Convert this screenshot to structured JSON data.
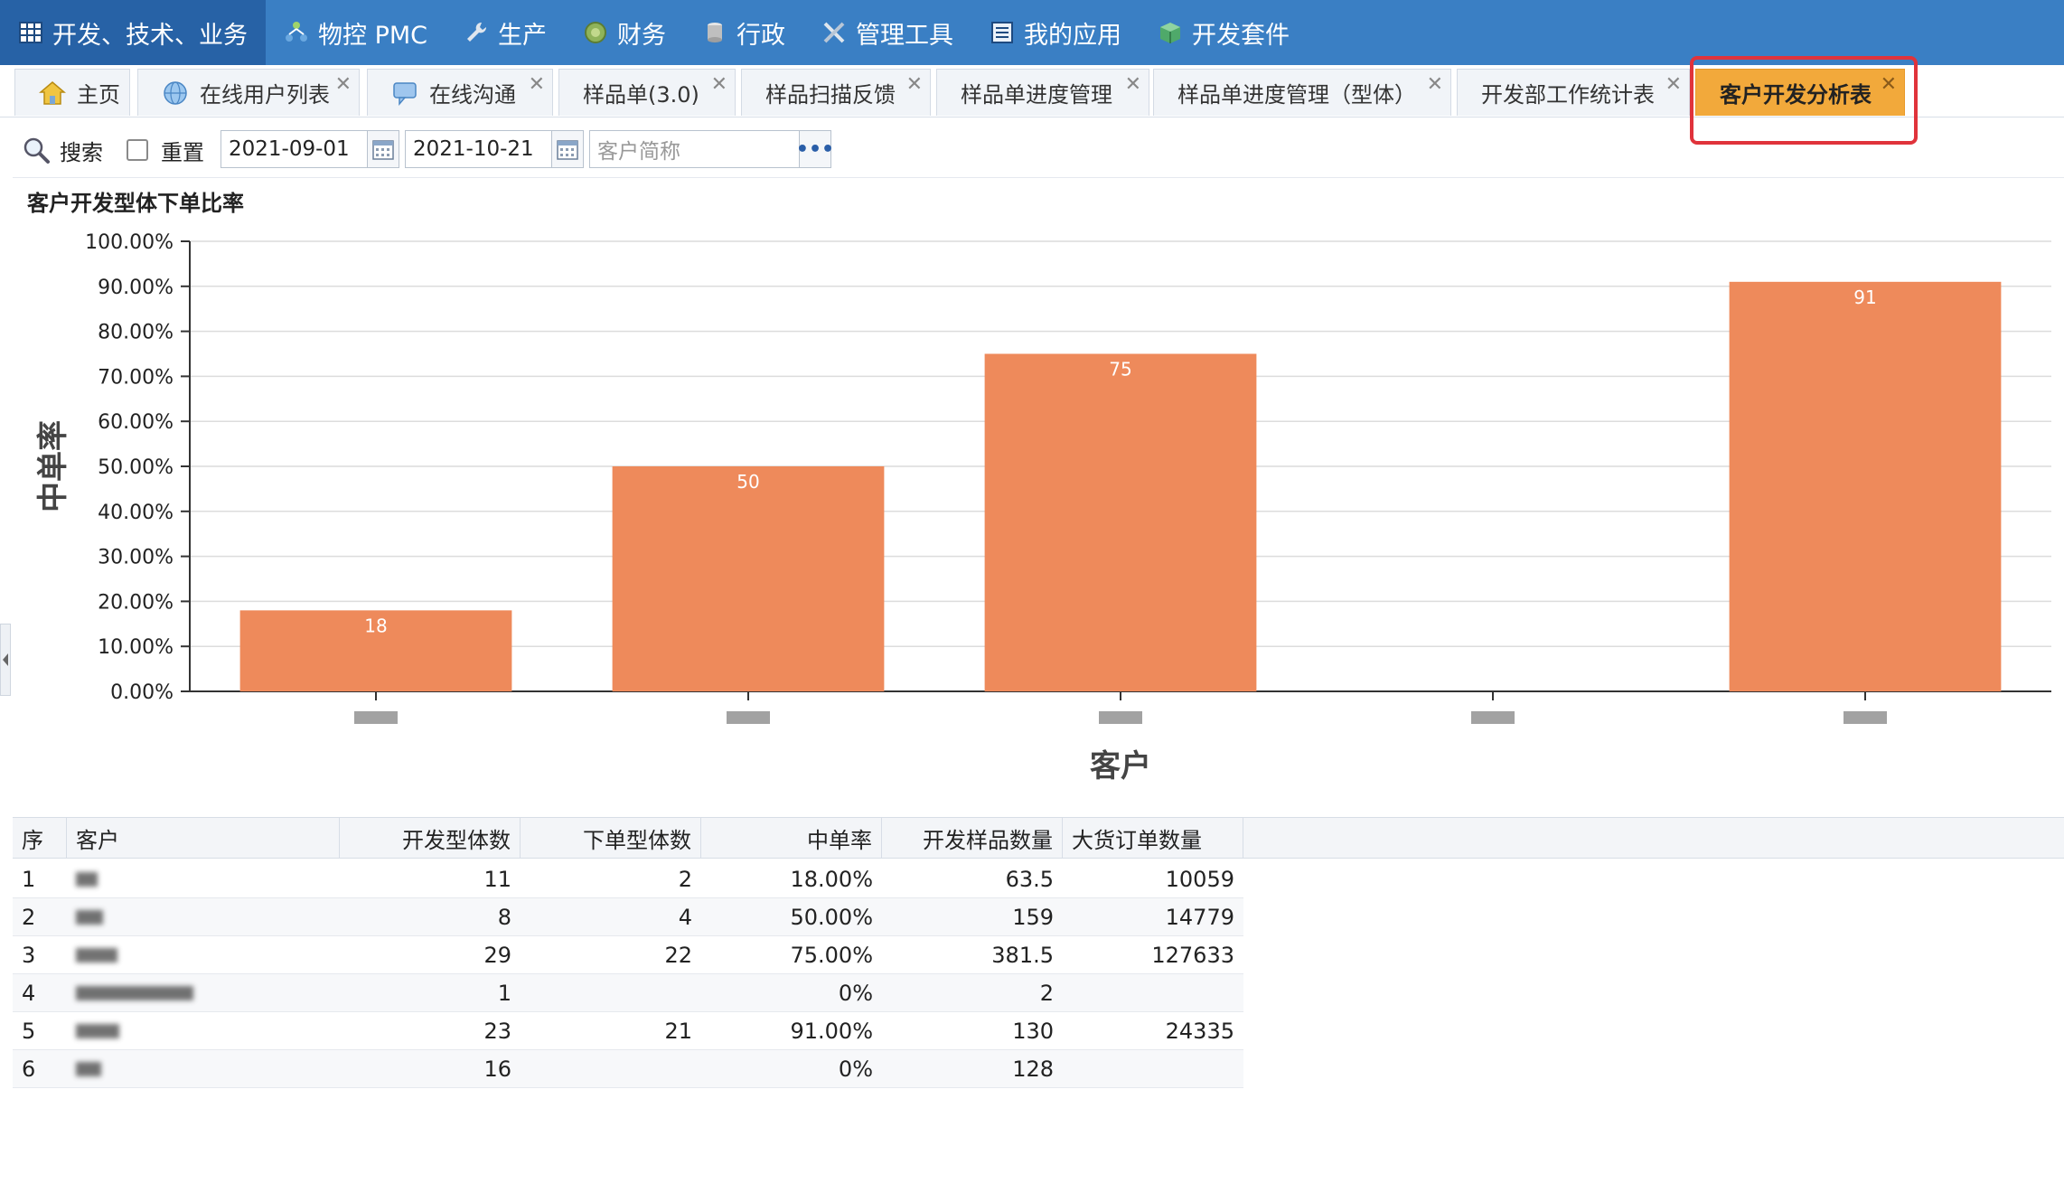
{
  "nav": {
    "items": [
      {
        "label": "开发、技术、业务",
        "icon": "grid-icon"
      },
      {
        "label": "物控 PMC",
        "icon": "network-icon"
      },
      {
        "label": "生产",
        "icon": "wrench-icon"
      },
      {
        "label": "财务",
        "icon": "coins-icon"
      },
      {
        "label": "行政",
        "icon": "database-icon"
      },
      {
        "label": "管理工具",
        "icon": "tools-icon"
      },
      {
        "label": "我的应用",
        "icon": "app-list-icon"
      },
      {
        "label": "开发套件",
        "icon": "package-icon"
      }
    ]
  },
  "tabs": [
    {
      "label": "主页",
      "icon": "home-icon",
      "closable": false
    },
    {
      "label": "在线用户列表",
      "icon": "globe-icon",
      "closable": true
    },
    {
      "label": "在线沟通",
      "icon": "chat-icon",
      "closable": true
    },
    {
      "label": "样品单(3.0)",
      "closable": true
    },
    {
      "label": "样品扫描反馈",
      "closable": true
    },
    {
      "label": "样品单进度管理",
      "closable": true
    },
    {
      "label": "样品单进度管理（型体）",
      "closable": true
    },
    {
      "label": "开发部工作统计表",
      "closable": true
    },
    {
      "label": "客户开发分析表",
      "closable": true,
      "active": true
    }
  ],
  "toolbar": {
    "search_label": "搜索",
    "reset_label": "重置",
    "start_date": "2021-09-01",
    "end_date": "2021-10-21",
    "customer_placeholder": "客户简称",
    "more_label": "•••"
  },
  "chart_data": {
    "type": "bar",
    "title": "客户开发型体下单比率",
    "xlabel": "客户",
    "ylabel": "中单率",
    "categories": [
      "",
      "",
      "",
      "",
      ""
    ],
    "values": [
      18,
      50,
      75,
      0,
      91
    ],
    "data_labels": [
      "18",
      "50",
      "75",
      "",
      "91"
    ],
    "ylim": [
      0,
      100
    ],
    "yticks": [
      "0.00%",
      "10.00%",
      "20.00%",
      "30.00%",
      "40.00%",
      "50.00%",
      "60.00%",
      "70.00%",
      "80.00%",
      "90.00%",
      "100.00%"
    ],
    "bar_color": "#ee8a5b",
    "grid": true
  },
  "table": {
    "headers": [
      "序",
      "客户",
      "开发型体数",
      "下单型体数",
      "中单率",
      "开发样品数量",
      "大货订单数量"
    ],
    "rows": [
      [
        "1",
        "",
        "11",
        "2",
        "18.00%",
        "63.5",
        "10059"
      ],
      [
        "2",
        "",
        "8",
        "4",
        "50.00%",
        "159",
        "14779"
      ],
      [
        "3",
        "",
        "29",
        "22",
        "75.00%",
        "381.5",
        "127633"
      ],
      [
        "4",
        "",
        "1",
        "",
        "0%",
        "2",
        ""
      ],
      [
        "5",
        "",
        "23",
        "21",
        "91.00%",
        "130",
        "24335"
      ],
      [
        "6",
        "",
        "16",
        "",
        "0%",
        "128",
        ""
      ]
    ]
  }
}
